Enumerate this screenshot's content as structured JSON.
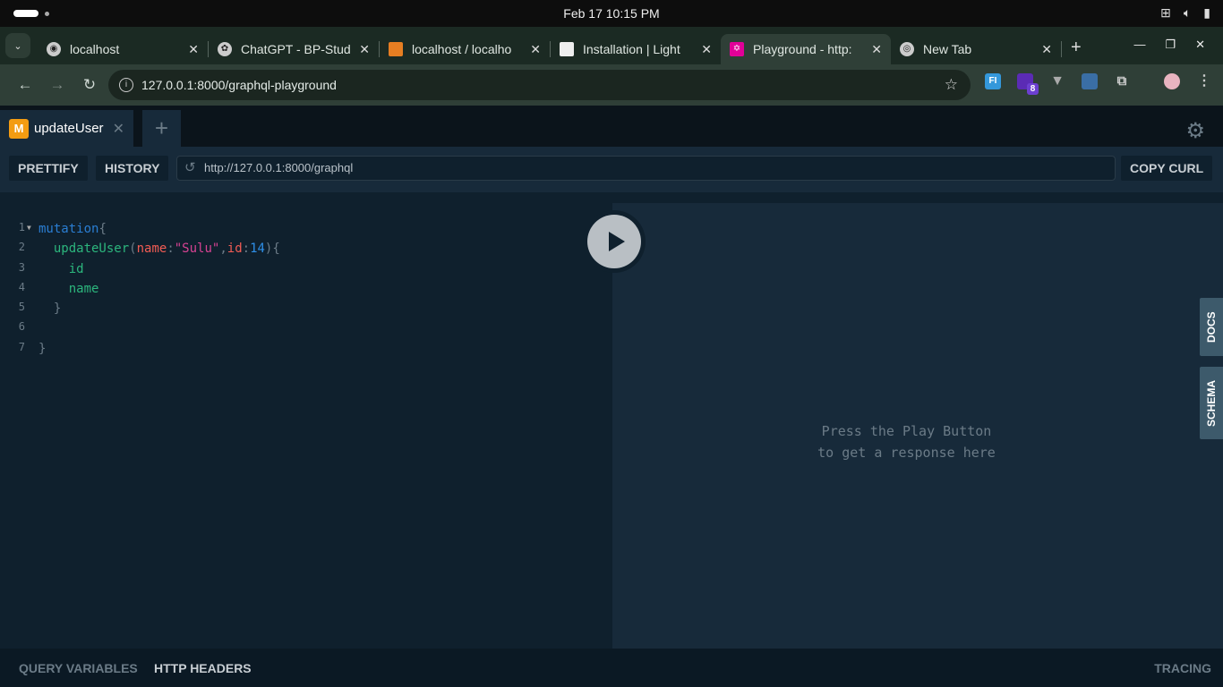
{
  "os": {
    "clock": "Feb 17  10:15 PM"
  },
  "browser": {
    "tabs": [
      {
        "title": "localhost",
        "active": false
      },
      {
        "title": "ChatGPT - BP-Stud",
        "active": false
      },
      {
        "title": "localhost / localho",
        "active": false
      },
      {
        "title": "Installation | Light",
        "active": false
      },
      {
        "title": "Playground - http:",
        "active": true
      },
      {
        "title": "New Tab",
        "active": false
      }
    ],
    "url": "127.0.0.1:8000/graphql-playground",
    "ext_badge": "8"
  },
  "playground": {
    "tab": {
      "badge": "M",
      "title": "updateUser"
    },
    "toolbar": {
      "prettify": "PRETTIFY",
      "history": "HISTORY",
      "endpoint": "http://127.0.0.1:8000/graphql",
      "copy_curl": "COPY CURL"
    },
    "editor": {
      "line_numbers": [
        "1",
        "2",
        "3",
        "4",
        "5",
        "6",
        "7"
      ]
    },
    "result": {
      "placeholder_line1": "Press the Play Button",
      "placeholder_line2": "to get a response here"
    },
    "side": {
      "docs": "DOCS",
      "schema": "SCHEMA"
    },
    "bottom": {
      "query_variables": "QUERY VARIABLES",
      "http_headers": "HTTP HEADERS",
      "tracing": "TRACING"
    }
  }
}
